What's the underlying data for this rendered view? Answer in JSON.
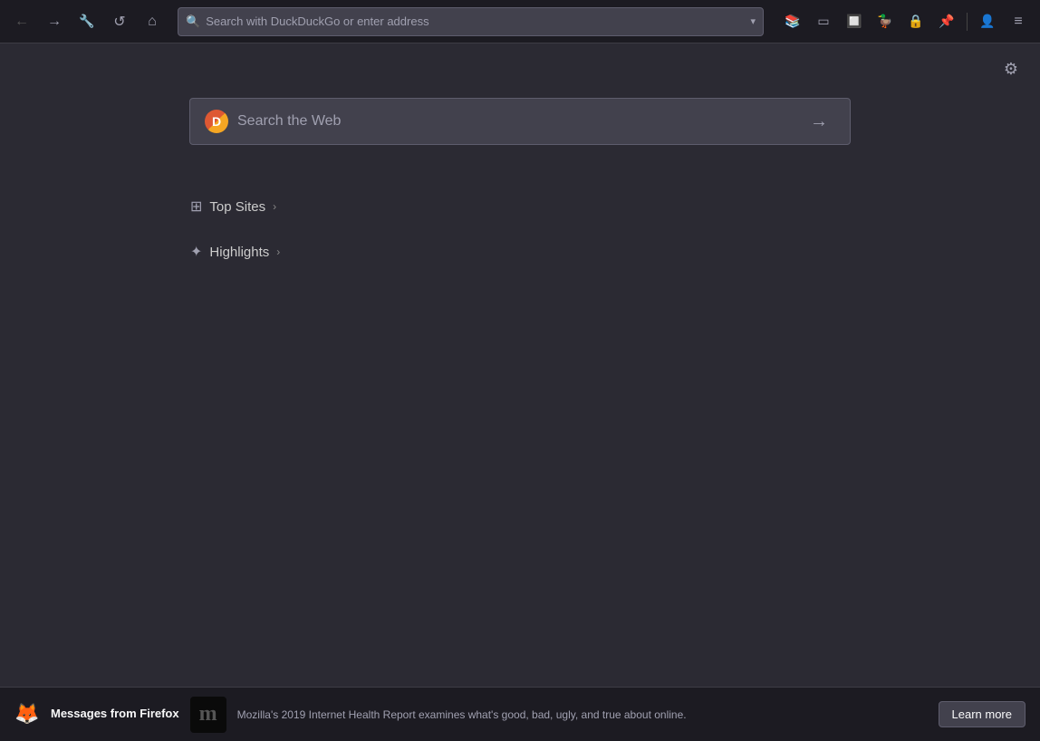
{
  "browser": {
    "back_button_label": "←",
    "forward_button_label": "→",
    "tools_button_label": "☰",
    "reload_button_label": "↺",
    "home_button_label": "⌂",
    "address_placeholder": "Search with DuckDuckGo or enter address",
    "dropdown_label": "▾"
  },
  "toolbar": {
    "library_icon": "📚",
    "sidebar_icon": "▭",
    "container_icon": "🔲",
    "extension1_icon": "🦆",
    "extension2_icon": "🔒",
    "extension3_icon": "📌",
    "account_icon": "👤",
    "menu_icon": "≡"
  },
  "page": {
    "settings_icon": "⚙",
    "search_placeholder": "Search the Web",
    "search_go_icon": "→",
    "ddg_logo_text": "D"
  },
  "sections": {
    "top_sites": {
      "label": "Top Sites",
      "icon": "⊞",
      "chevron": "›"
    },
    "highlights": {
      "label": "Highlights",
      "icon": "✦",
      "chevron": "›"
    }
  },
  "bottom_bar": {
    "title": "Messages from Firefox",
    "article_thumb": "m",
    "article_text": "Mozilla's 2019 Internet Health Report examines what's good, bad, ugly, and true about online.",
    "learn_more_label": "Learn more",
    "firefox_icon": "🦊"
  }
}
